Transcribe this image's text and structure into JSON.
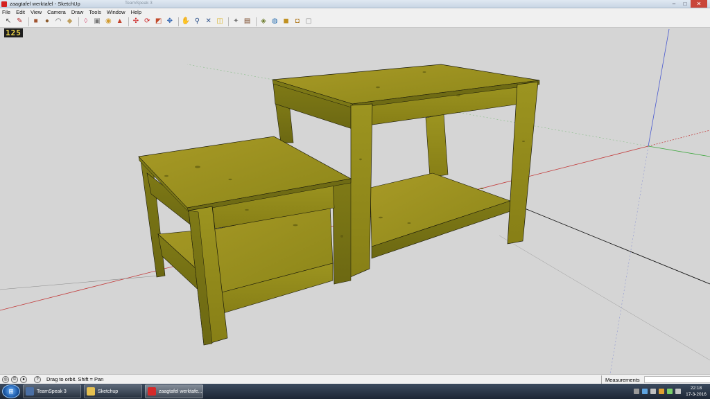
{
  "window": {
    "title": "zaagtafel werktafel - SketchUp",
    "ghost_title": "TeamSpeak 3",
    "controls": {
      "minimize": "–",
      "maximize": "□",
      "close": "✕"
    }
  },
  "menu": [
    "File",
    "Edit",
    "View",
    "Camera",
    "Draw",
    "Tools",
    "Window",
    "Help"
  ],
  "toolbar": {
    "tools": [
      {
        "name": "select-tool",
        "glyph": "↖",
        "color": "#444444"
      },
      {
        "name": "pencil-tool",
        "glyph": "✎",
        "color": "#b22222"
      },
      {
        "name": "rectangle-tool",
        "glyph": "■",
        "color": "#a0522d"
      },
      {
        "name": "circle-tool",
        "glyph": "●",
        "color": "#8b5a2b"
      },
      {
        "name": "arc-tool",
        "glyph": "◠",
        "color": "#555555"
      },
      {
        "name": "make-component-tool",
        "glyph": "◆",
        "color": "#c0a060"
      },
      {
        "name": "eraser-tool",
        "glyph": "◊",
        "color": "#d86b8a"
      },
      {
        "name": "tape-measure-tool",
        "glyph": "▣",
        "color": "#777777"
      },
      {
        "name": "paint-bucket-tool",
        "glyph": "◉",
        "color": "#d29b2c"
      },
      {
        "name": "push-pull-tool",
        "glyph": "▲",
        "color": "#c2402a"
      },
      {
        "name": "move-tool",
        "glyph": "✣",
        "color": "#cc2222"
      },
      {
        "name": "rotate-tool",
        "glyph": "⟳",
        "color": "#cc2222"
      },
      {
        "name": "offset-tool",
        "glyph": "◩",
        "color": "#c24a2a"
      },
      {
        "name": "orbit-tool",
        "glyph": "✥",
        "color": "#2a5fb0"
      },
      {
        "name": "pan-tool",
        "glyph": "✋",
        "color": "#555555"
      },
      {
        "name": "zoom-tool",
        "glyph": "⚲",
        "color": "#2a4f8a"
      },
      {
        "name": "zoom-extents-tool",
        "glyph": "✕",
        "color": "#2a4f8a"
      },
      {
        "name": "previous-view-tool",
        "glyph": "◫",
        "color": "#d8b020"
      },
      {
        "name": "next-view-tool",
        "glyph": "✦",
        "color": "#777777"
      },
      {
        "name": "3d-warehouse-tool",
        "glyph": "▤",
        "color": "#7a4a2a"
      },
      {
        "name": "share-model-tool",
        "glyph": "◈",
        "color": "#6a7a2a"
      },
      {
        "name": "geo-location-tool",
        "glyph": "◍",
        "color": "#2a6fb0"
      },
      {
        "name": "component-tool",
        "glyph": "◼",
        "color": "#c09020"
      },
      {
        "name": "extension-tool",
        "glyph": "◘",
        "color": "#b07a20"
      },
      {
        "name": "styles-tool",
        "glyph": "▢",
        "color": "#888888"
      }
    ]
  },
  "viewport": {
    "scale_badge": "125",
    "background": "#d5d5d5",
    "wood_light": "#a69a24",
    "wood_mid": "#8e8a1c",
    "wood_dark": "#6f6c14",
    "axis_red": "#c23a3a",
    "axis_green": "#3fa83f",
    "axis_blue": "#4a5ad0"
  },
  "statusbar": {
    "icons": [
      "geo-location-icon",
      "credits-icon",
      "sign-in-icon",
      "help-icon"
    ],
    "hint": "Drag to orbit.  Shift = Pan",
    "measurements_label": "Measurements",
    "measurements_value": ""
  },
  "taskbar": {
    "tasks": [
      {
        "label": "TeamSpeak 3",
        "name": "task-teamspeak",
        "color": "#4a6fa5",
        "active": false
      },
      {
        "label": "Sketchup",
        "name": "task-sketchup-folder",
        "color": "#e5c050",
        "active": false
      },
      {
        "label": "zaagtafel werktafe...",
        "name": "task-sketchup-window",
        "color": "#d42a2a",
        "active": true
      }
    ],
    "tray_colors": [
      "#9a9a9a",
      "#5fa4e0",
      "#c0c0c0",
      "#e0a030",
      "#7ad06a",
      "#c4c4c4"
    ],
    "clock_time": "22:18",
    "clock_date": "17-3-2016"
  }
}
